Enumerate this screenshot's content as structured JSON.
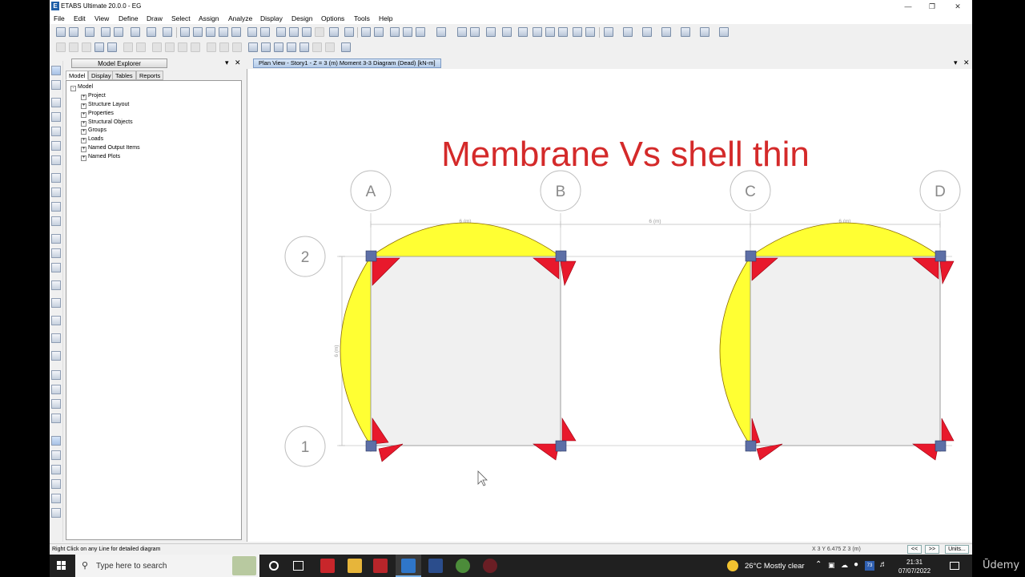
{
  "window": {
    "title": "ETABS Ultimate 20.0.0 - EG",
    "app_icon": "E"
  },
  "menu": [
    "File",
    "Edit",
    "View",
    "Define",
    "Draw",
    "Select",
    "Assign",
    "Analyze",
    "Display",
    "Design",
    "Options",
    "Tools",
    "Help"
  ],
  "explorer": {
    "title": "Model Explorer",
    "tabs": [
      "Model",
      "Display",
      "Tables",
      "Reports"
    ],
    "root": "Model",
    "items": [
      "Project",
      "Structure Layout",
      "Properties",
      "Structural Objects",
      "Groups",
      "Loads",
      "Named Output Items",
      "Named Plots"
    ]
  },
  "view_tab": "Plan View - Story1 - Z = 3 (m)    Moment 3-3 Diagram   (Dead)  [kN-m]",
  "annotation": "Membrane Vs shell thin",
  "grid": {
    "columns": [
      "A",
      "B",
      "C",
      "D"
    ],
    "rows": [
      "2",
      "1"
    ],
    "span_labels": [
      "6 (m)",
      "6 (m)",
      "6 (m)"
    ],
    "vertical_span_label": "6 (m)"
  },
  "colors": {
    "diagram_fill": "#ffff33",
    "hinge_red": "#e8192c",
    "support_blue": "#5d6fa6",
    "annotation": "#d42a2a",
    "slab": "#f0f0f0"
  },
  "statusbar": {
    "hint": "Right Click on any Line for detailed diagram",
    "coords": "X 3  Y 6.475  Z 3 (m)",
    "buttons": [
      "<<",
      ">>",
      "Units..."
    ]
  },
  "taskbar": {
    "search_placeholder": "Type here to search",
    "weather": "26°C  Mostly clear",
    "time": "21:31",
    "date": "07/07/2022"
  },
  "watermark": "Ūdemy"
}
